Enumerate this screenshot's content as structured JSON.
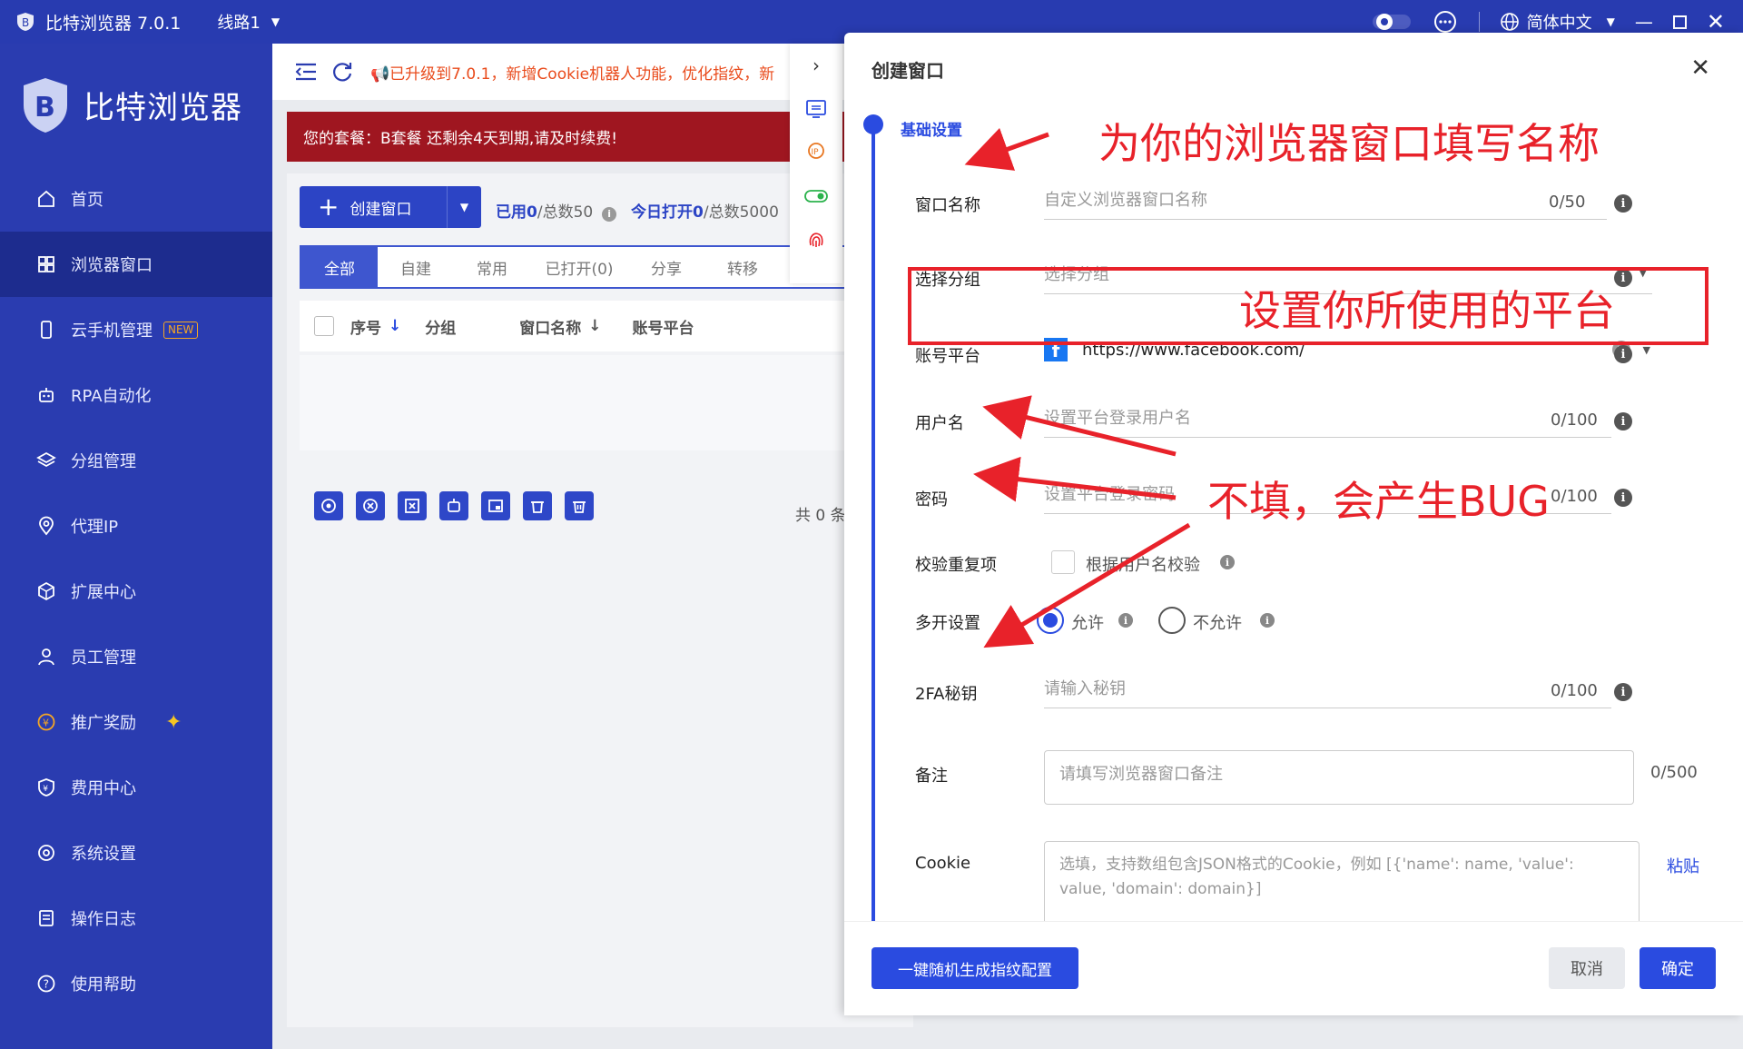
{
  "titlebar": {
    "app_title": "比特浏览器 7.0.1",
    "line": "线路1",
    "language": "简体中文"
  },
  "sidebar": {
    "brand": "比特浏览器",
    "items": [
      {
        "label": "首页",
        "icon": "home-icon"
      },
      {
        "label": "浏览器窗口",
        "icon": "grid-icon",
        "active": true
      },
      {
        "label": "云手机管理",
        "icon": "phone-icon",
        "badge": "NEW"
      },
      {
        "label": "RPA自动化",
        "icon": "robot-icon"
      },
      {
        "label": "分组管理",
        "icon": "layers-icon"
      },
      {
        "label": "代理IP",
        "icon": "location-icon"
      },
      {
        "label": "扩展中心",
        "icon": "cube-icon"
      },
      {
        "label": "员工管理",
        "icon": "user-icon"
      },
      {
        "label": "推广奖励",
        "icon": "coin-icon"
      },
      {
        "label": "费用中心",
        "icon": "shield-yen-icon"
      },
      {
        "label": "系统设置",
        "icon": "settings-icon"
      },
      {
        "label": "操作日志",
        "icon": "log-icon"
      },
      {
        "label": "使用帮助",
        "icon": "help-icon"
      }
    ]
  },
  "main": {
    "notice": "已升级到7.0.1，新增Cookie机器人功能，优化指纹，新",
    "plan_alert": "您的套餐：B套餐 还剩余4天到期,请及时续费!",
    "create_button": "创建窗口",
    "usage_used": "已用0",
    "usage_total": "/总数50",
    "today_open": "今日打开0",
    "today_total": "/总数5000",
    "tabs": [
      "全部",
      "自建",
      "常用",
      "已打开(0)",
      "分享",
      "转移"
    ],
    "columns": [
      "序号",
      "分组",
      "窗口名称",
      "账号平台"
    ],
    "total_text": "共 0 条"
  },
  "dialog": {
    "title": "创建窗口",
    "section": "基础设置",
    "window_name": {
      "label": "窗口名称",
      "placeholder": "自定义浏览器窗口名称",
      "count": "0/50"
    },
    "group": {
      "label": "选择分组",
      "placeholder": "选择分组"
    },
    "platform": {
      "label": "账号平台",
      "value": "https://www.facebook.com/"
    },
    "username": {
      "label": "用户名",
      "placeholder": "设置平台登录用户名",
      "count": "0/100"
    },
    "password": {
      "label": "密码",
      "placeholder": "设置平台登录密码",
      "count": "0/100"
    },
    "dup_check": {
      "label": "校验重复项",
      "option": "根据用户名校验"
    },
    "multi_open": {
      "label": "多开设置",
      "allow": "允许",
      "deny": "不允许"
    },
    "twofa": {
      "label": "2FA秘钥",
      "placeholder": "请输入秘钥",
      "count": "0/100"
    },
    "remark": {
      "label": "备注",
      "placeholder": "请填写浏览器窗口备注",
      "count": "0/500"
    },
    "cookie": {
      "label": "Cookie",
      "placeholder": "选填，支持数组包含JSON格式的Cookie，例如 [{'name': name, 'value': value, 'domain': domain}]",
      "paste": "粘贴"
    },
    "random_button": "一键随机生成指纹配置",
    "cancel_button": "取消",
    "ok_button": "确定"
  },
  "annotations": {
    "name_hint": "为你的浏览器窗口填写名称",
    "platform_hint": "设置你所使用的平台",
    "bug_hint": "不填，会产生BUG"
  },
  "colors": {
    "primary": "#2a4be0",
    "sidebar": "#2a3cb0",
    "annotation": "#e8222a",
    "alert": "#9f1620"
  }
}
